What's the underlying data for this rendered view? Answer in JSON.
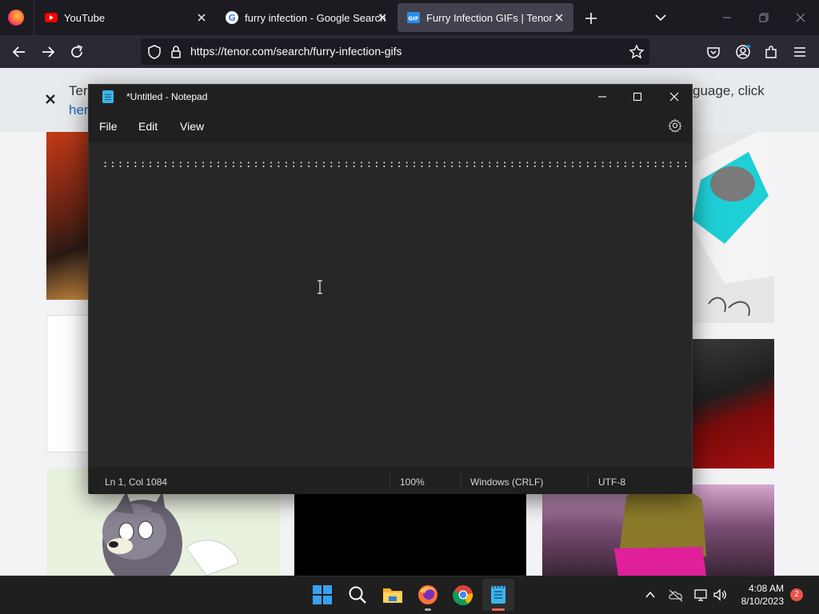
{
  "browser": {
    "tabs": [
      {
        "label": "YouTube",
        "icon": "youtube-favicon",
        "active": false
      },
      {
        "label": "furry infection - Google Search",
        "icon": "google-favicon",
        "active": false
      },
      {
        "label": "Furry Infection GIFs | Tenor",
        "icon": "tenor-favicon",
        "active": true
      }
    ],
    "url": "https://tenor.com/search/furry-infection-gifs",
    "colors": {
      "tabbar": "#1c1b22",
      "navbar": "#2b2a33",
      "active_tab": "#42414d"
    }
  },
  "page": {
    "banner": {
      "left_text": "Ter",
      "left_link": "her",
      "right_text": "guage, click"
    }
  },
  "notepad": {
    "title": "*Untitled - Notepad",
    "menu": [
      "File",
      "Edit",
      "View"
    ],
    "lines": [
      ":::::::::::::::::::::::::::::::::::::::::::::::::::::::::::::::::::::::::::::::::::::::::::::::::::::::::::::::::::::::::::::::"
    ],
    "status": {
      "position": "Ln 1, Col 1084",
      "zoom": "100%",
      "line_ending": "Windows (CRLF)",
      "encoding": "UTF-8"
    }
  },
  "taskbar": {
    "apps": [
      "windows-start",
      "search",
      "file-explorer",
      "firefox",
      "chrome",
      "notepad"
    ],
    "clock": {
      "time": "4:08 AM",
      "date": "8/10/2023"
    },
    "notification_count": "2"
  }
}
